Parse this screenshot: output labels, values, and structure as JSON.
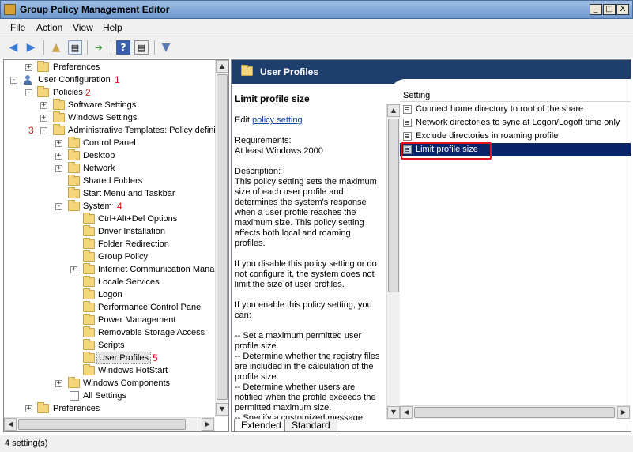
{
  "window": {
    "title": "Group Policy Management Editor",
    "minimize_glyph": "_",
    "maximize_glyph": "□",
    "close_glyph": "X"
  },
  "menu": [
    "File",
    "Action",
    "View",
    "Help"
  ],
  "toolbar_icons": [
    "back-arrow-icon",
    "forward-arrow-icon",
    "up-folder-icon",
    "show-hide-tree-icon",
    "export-list-icon",
    "help-icon",
    "properties-icon",
    "filter-icon"
  ],
  "tree": {
    "items": [
      {
        "label": "Preferences",
        "expander": "+",
        "num": ""
      },
      {
        "label": "User Configuration",
        "expander": "-",
        "num": "1"
      },
      {
        "label": "Policies",
        "expander": "-",
        "num": "2"
      },
      {
        "label": "Software Settings",
        "expander": "+",
        "num": ""
      },
      {
        "label": "Windows Settings",
        "expander": "+",
        "num": ""
      },
      {
        "label": "Administrative Templates: Policy defini",
        "expander": "-",
        "num": "3"
      },
      {
        "label": "Control Panel",
        "expander": "+",
        "num": ""
      },
      {
        "label": "Desktop",
        "expander": "+",
        "num": ""
      },
      {
        "label": "Network",
        "expander": "+",
        "num": ""
      },
      {
        "label": "Shared Folders",
        "expander": "",
        "num": ""
      },
      {
        "label": "Start Menu and Taskbar",
        "expander": "",
        "num": ""
      },
      {
        "label": "System",
        "expander": "-",
        "num": "4"
      },
      {
        "label": "Ctrl+Alt+Del Options",
        "expander": "",
        "num": ""
      },
      {
        "label": "Driver Installation",
        "expander": "",
        "num": ""
      },
      {
        "label": "Folder Redirection",
        "expander": "",
        "num": ""
      },
      {
        "label": "Group Policy",
        "expander": "",
        "num": ""
      },
      {
        "label": "Internet Communication Manag",
        "expander": "+",
        "num": ""
      },
      {
        "label": "Locale Services",
        "expander": "",
        "num": ""
      },
      {
        "label": "Logon",
        "expander": "",
        "num": ""
      },
      {
        "label": "Performance Control Panel",
        "expander": "",
        "num": ""
      },
      {
        "label": "Power Management",
        "expander": "",
        "num": ""
      },
      {
        "label": "Removable Storage Access",
        "expander": "",
        "num": ""
      },
      {
        "label": "Scripts",
        "expander": "",
        "num": ""
      },
      {
        "label": "User Profiles",
        "expander": "",
        "num": "5"
      },
      {
        "label": "Windows HotStart",
        "expander": "",
        "num": ""
      },
      {
        "label": "Windows Components",
        "expander": "+",
        "num": ""
      },
      {
        "label": "All Settings",
        "expander": "",
        "num": ""
      },
      {
        "label": "Preferences",
        "expander": "+",
        "num": ""
      }
    ]
  },
  "right_pane": {
    "header_title": "User Profiles",
    "policy_title": "Limit profile size",
    "edit_prefix": "Edit ",
    "edit_link": "policy setting",
    "requirements_label": "Requirements:",
    "requirements_value": "At least Windows 2000",
    "description_label": "Description:",
    "description_p1": "This policy setting sets the maximum size of each user profile and determines the system's response when a user profile reaches the maximum size. This policy setting affects both local and roaming profiles.",
    "description_p2": "If you disable this policy setting or do not configure it, the system does not limit the size of user profiles.",
    "description_p3": "If you enable this policy setting, you can:",
    "description_p4": "-- Set a maximum permitted user profile size.\n-- Determine whether the registry files are included in the calculation of the profile size.\n-- Determine whether users are notified when the profile exceeds the permitted maximum size.\n-- Specify a customized message",
    "column_header": "Setting",
    "settings": [
      "Connect home directory to root of the share",
      "Network directories to sync at Logon/Logoff time only",
      "Exclude directories in roaming profile",
      "Limit profile size"
    ],
    "selected_index": 3
  },
  "tabs": [
    "Extended",
    "Standard"
  ],
  "status": "4 setting(s)"
}
